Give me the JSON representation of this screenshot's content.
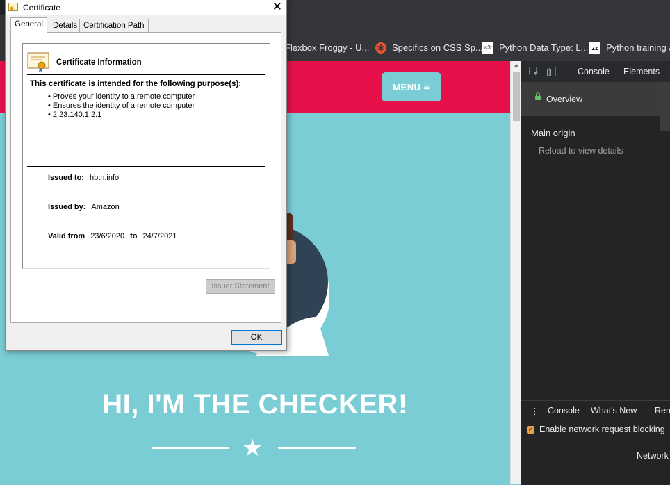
{
  "bookmarks": [
    {
      "label": "Flexbox Froggy - U...",
      "icon": "frog-icon"
    },
    {
      "label": "Specifics on CSS Sp...",
      "icon": "asterisk-icon"
    },
    {
      "label": "Python Data Type: L...",
      "icon": "w3r-icon",
      "icon_text": "w3r"
    },
    {
      "label": "Python training a",
      "icon": "zz-icon",
      "icon_text": "zz"
    }
  ],
  "page": {
    "menu_label": "MENU",
    "menu_icon": "≡",
    "headline": "HI, I'M THE CHECKER!",
    "star": "★"
  },
  "devtools": {
    "tabs": {
      "console": "Console",
      "elements": "Elements"
    },
    "overview": "Overview",
    "main_origin": "Main origin",
    "reload": "Reload to view details",
    "drawer_tabs": {
      "console": "Console",
      "whats_new": "What's New",
      "rendering": "Rend"
    },
    "network_blocking": "Enable network request blocking",
    "network_label": "Network"
  },
  "dialog": {
    "title": "Certificate",
    "close": "✕",
    "tabs": [
      "General",
      "Details",
      "Certification Path"
    ],
    "heading": "Certificate Information",
    "purpose_title": "This certificate is intended for the following purpose(s):",
    "purposes": [
      "Proves your identity to a remote computer",
      "Ensures the identity of a remote computer",
      "2.23.140.1.2.1"
    ],
    "issued_to_label": "Issued to:",
    "issued_to": "hbtn.info",
    "issued_by_label": "Issued by:",
    "issued_by": "Amazon",
    "valid_from_label": "Valid from",
    "valid_from": "23/6/2020",
    "to_label": "to",
    "valid_to": "24/7/2021",
    "issuer_statement": "Issuer Statement",
    "ok": "OK"
  },
  "colors": {
    "hero_red": "#e6114a",
    "teal": "#7acdd4",
    "dialog_focus": "#0078d7"
  }
}
